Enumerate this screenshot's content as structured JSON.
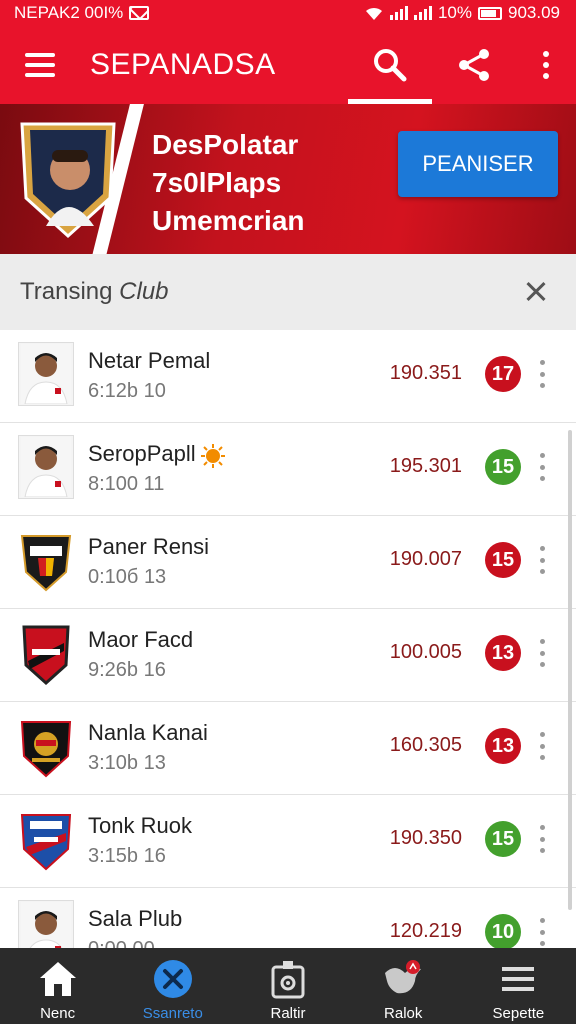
{
  "status_bar": {
    "left_text": "NEPAK2 00I%",
    "battery_pct": "10%",
    "time": "903.09"
  },
  "app_bar": {
    "title": "SEPANADSA"
  },
  "banner": {
    "line1": "DesPolatar",
    "line2": "7s0lPlaps",
    "line3": "Umemcrian",
    "button_label": "PEANISER"
  },
  "section": {
    "title_prefix": "Transing",
    "title_italic": "Club"
  },
  "rows": [
    {
      "name": "Netar Pemal",
      "sub": "6:12b 10",
      "value": "190.351",
      "badge": "17",
      "badge_color": "red",
      "avatar": "player"
    },
    {
      "name": "SeropPapll",
      "sub": "8:100 11",
      "value": "195.301",
      "badge": "15",
      "badge_color": "green",
      "avatar": "player"
    },
    {
      "name": "Paner Rensi",
      "sub": "0:10б 13",
      "value": "190.007",
      "badge": "15",
      "badge_color": "red",
      "avatar": "crest-black-red"
    },
    {
      "name": "Maor Facd",
      "sub": "9:26b 16",
      "value": "100.005",
      "badge": "13",
      "badge_color": "red",
      "avatar": "crest-red-stripe"
    },
    {
      "name": "Nanla Kanai",
      "sub": "3:10b 13",
      "value": "160.305",
      "badge": "13",
      "badge_color": "red",
      "avatar": "crest-black-gold"
    },
    {
      "name": "Tonk Ruok",
      "sub": "3:15b 16",
      "value": "190.350",
      "badge": "15",
      "badge_color": "green",
      "avatar": "crest-blue-red"
    },
    {
      "name": "Sala Plub",
      "sub": "0:00 00",
      "value": "120.219",
      "badge": "10",
      "badge_color": "green",
      "avatar": "player"
    }
  ],
  "bottom_nav": [
    {
      "label": "Nenc",
      "icon": "home-icon"
    },
    {
      "label": "Ssanreto",
      "icon": "close-circle-icon"
    },
    {
      "label": "Raltir",
      "icon": "gadget-icon"
    },
    {
      "label": "Ralok",
      "icon": "bird-icon"
    },
    {
      "label": "Sepette",
      "icon": "list-icon"
    }
  ],
  "colors": {
    "brand_red": "#e8132b",
    "button_blue": "#1c79d8",
    "badge_red": "#c8101e",
    "badge_green": "#43a02d"
  }
}
